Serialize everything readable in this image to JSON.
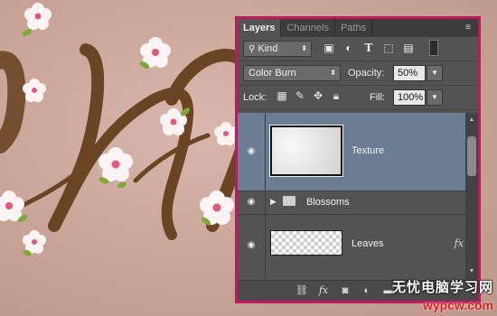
{
  "panel": {
    "tabs": [
      {
        "label": "Layers",
        "active": true
      },
      {
        "label": "Channels",
        "active": false
      },
      {
        "label": "Paths",
        "active": false
      }
    ],
    "menu_icon": "panel-menu-icon"
  },
  "filter": {
    "kind_label": "Kind",
    "filter_icons": [
      "image-filter-icon",
      "adjustment-filter-icon",
      "type-filter-icon",
      "shape-filter-icon",
      "smartobject-filter-icon",
      "filter-toggle-icon"
    ]
  },
  "blend": {
    "mode": "Color Burn",
    "opacity_label": "Opacity:",
    "opacity_value": "50%"
  },
  "lock": {
    "lock_label": "Lock:",
    "fill_label": "Fill:",
    "fill_value": "100%"
  },
  "layers": [
    {
      "name": "Texture",
      "selected": true,
      "visible": true,
      "type": "pixel"
    },
    {
      "name": "Blossoms",
      "selected": false,
      "visible": true,
      "type": "group"
    },
    {
      "name": "Leaves",
      "selected": false,
      "visible": true,
      "type": "pixel",
      "has_fx": true,
      "fx_label": "fx"
    }
  ],
  "footer": {
    "icons": [
      "link-layers-icon",
      "fx-icon",
      "layer-mask-icon",
      "adjustment-layer-icon",
      "new-group-icon",
      "new-layer-icon",
      "delete-layer-icon"
    ],
    "fx_label": "fx"
  },
  "watermark": {
    "line1": "无忧电脑学习网",
    "line2": "wypcw.com"
  },
  "colors": {
    "accent_border": "#c0185f",
    "selected_row": "#6b7d92",
    "panel_bg": "#535353",
    "canvas_bg": "#cba89e"
  }
}
